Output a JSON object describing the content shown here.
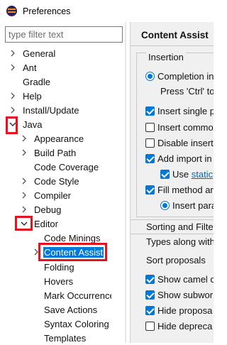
{
  "window": {
    "title": "Preferences"
  },
  "filter": {
    "placeholder": "type filter text",
    "value": ""
  },
  "tree": [
    {
      "label": "General",
      "expanded": false
    },
    {
      "label": "Ant",
      "expanded": false
    },
    {
      "label": "Gradle",
      "expanded": null
    },
    {
      "label": "Help",
      "expanded": false
    },
    {
      "label": "Install/Update",
      "expanded": false
    },
    {
      "label": "Java",
      "expanded": true
    },
    {
      "label": "Appearance",
      "expanded": false
    },
    {
      "label": "Build Path",
      "expanded": false
    },
    {
      "label": "Code Coverage",
      "expanded": null
    },
    {
      "label": "Code Style",
      "expanded": false
    },
    {
      "label": "Compiler",
      "expanded": false
    },
    {
      "label": "Debug",
      "expanded": false
    },
    {
      "label": "Editor",
      "expanded": true
    },
    {
      "label": "Code Minings",
      "expanded": null
    },
    {
      "label": "Content Assist",
      "expanded": false,
      "selected": true
    },
    {
      "label": "Folding",
      "expanded": null
    },
    {
      "label": "Hovers",
      "expanded": null
    },
    {
      "label": "Mark Occurrences",
      "expanded": null
    },
    {
      "label": "Save Actions",
      "expanded": null
    },
    {
      "label": "Syntax Coloring",
      "expanded": null
    },
    {
      "label": "Templates",
      "expanded": null
    }
  ],
  "page": {
    "title": "Content Assist",
    "insertion_group": "Insertion",
    "completion_option": "Completion in",
    "completion_hint": "Press 'Ctrl' to",
    "insert_single": "Insert single p",
    "insert_common": "Insert commo",
    "disable_insert": "Disable insert",
    "add_import": "Add import in",
    "use_prefix": "Use ",
    "use_link": "static",
    "fill_method": "Fill method ar",
    "insert_params": "Insert para",
    "sorting_filter": "Sorting and Filte",
    "types_along": "Types along with",
    "sort_proposals": "Sort proposals",
    "show_camel": "Show camel c",
    "show_subword": "Show subwor",
    "hide_proposals": "Hide proposa",
    "hide_deprecated": "Hide depreca"
  },
  "colors": {
    "selection": "#0078d7",
    "highlight_box": "#e4131f",
    "pane_background": "#f0f0f0"
  },
  "icons": {
    "app": "eclipse-icon",
    "collapsed": "chevron-right-icon",
    "expanded": "chevron-down-icon"
  }
}
